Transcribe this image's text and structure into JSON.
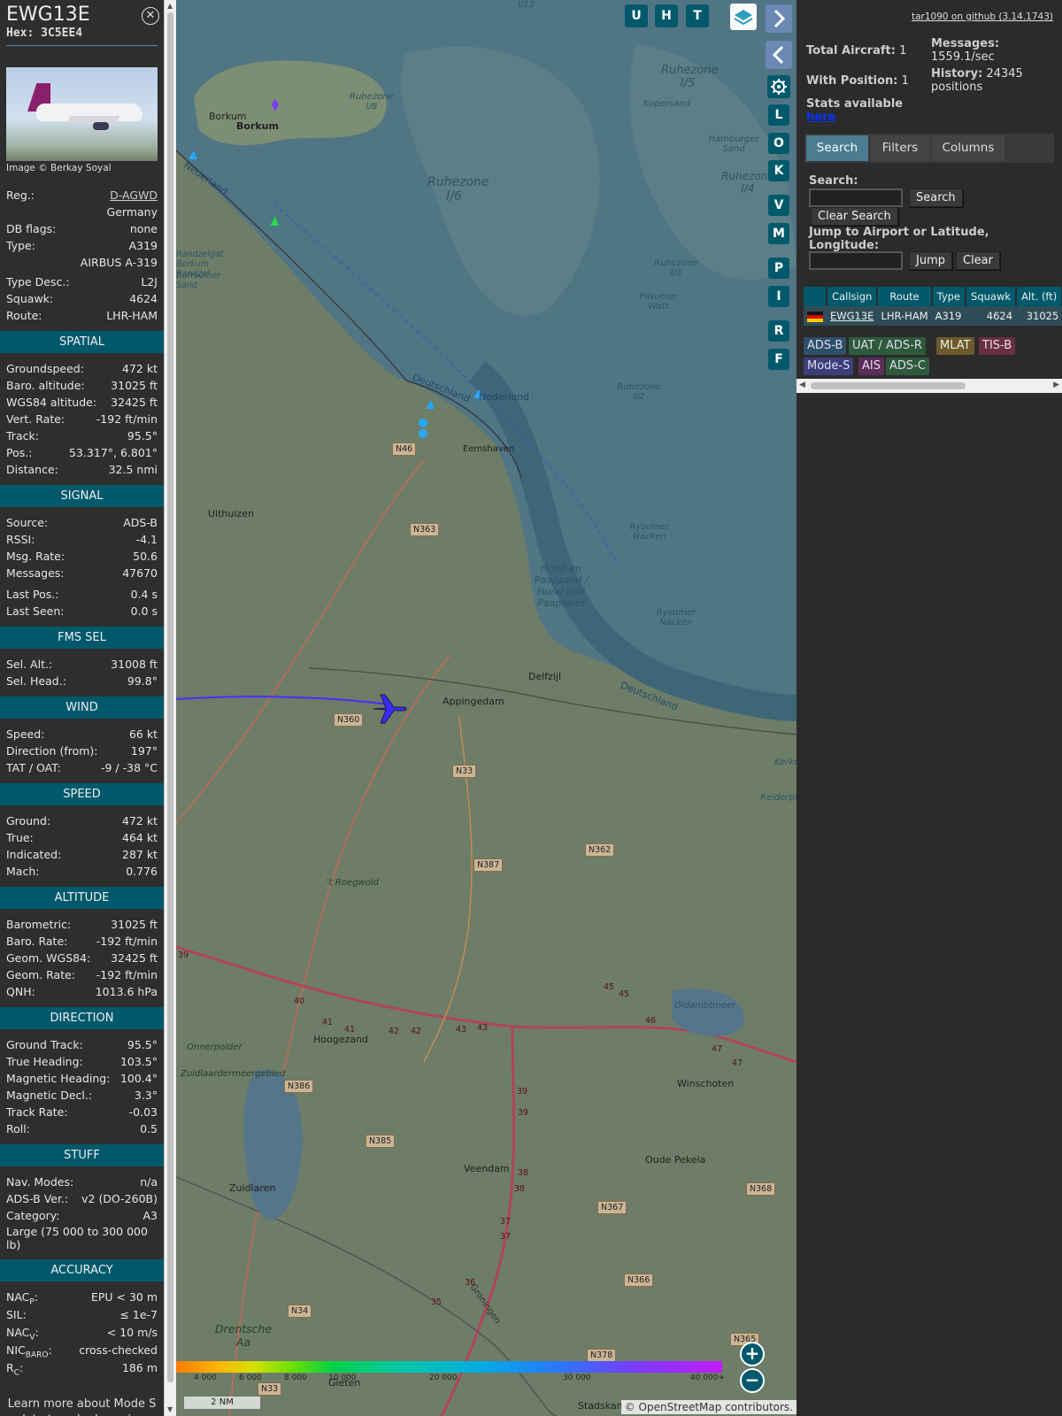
{
  "info": {
    "callsign": "EWG13E",
    "hex": "Hex: 3C5EE4",
    "photo_credit": "Image © Berkay Soyal",
    "reg_label": "Reg.:",
    "reg_value": "D-AGWD",
    "country": "Germany",
    "dbflags_label": "DB flags:",
    "dbflags_value": "none",
    "type_label": "Type:",
    "type_value": "A319",
    "type_name": "AIRBUS A-319",
    "typedesc_label": "Type Desc.:",
    "typedesc_value": "L2J",
    "squawk_label": "Squawk:",
    "squawk_value": "4624",
    "route_label": "Route:",
    "route_value": "LHR-HAM",
    "sections": {
      "spatial": "SPATIAL",
      "signal": "SIGNAL",
      "fms": "FMS SEL",
      "wind": "WIND",
      "speed": "SPEED",
      "altitude": "ALTITUDE",
      "direction": "DIRECTION",
      "stuff": "STUFF",
      "accuracy": "ACCURACY"
    },
    "spatial": [
      {
        "label": "Groundspeed:",
        "value": "472 kt"
      },
      {
        "label": "Baro. altitude:",
        "value": "31025 ft"
      },
      {
        "label": "WGS84 altitude:",
        "value": "32425 ft"
      },
      {
        "label": "Vert. Rate:",
        "value": "-192 ft/min"
      },
      {
        "label": "Track:",
        "value": "95.5°"
      },
      {
        "label": "Pos.:",
        "value": "53.317°, 6.801°"
      },
      {
        "label": "Distance:",
        "value": "32.5 nmi"
      }
    ],
    "signal": [
      {
        "label": "Source:",
        "value": "ADS-B"
      },
      {
        "label": "RSSI:",
        "value": "-4.1"
      },
      {
        "label": "Msg. Rate:",
        "value": "50.6"
      },
      {
        "label": "Messages:",
        "value": "47670"
      }
    ],
    "signal2": [
      {
        "label": "Last Pos.:",
        "value": "0.4 s"
      },
      {
        "label": "Last Seen:",
        "value": "0.0 s"
      }
    ],
    "fms": [
      {
        "label": "Sel. Alt.:",
        "value": "31008 ft"
      },
      {
        "label": "Sel. Head.:",
        "value": "99.8°"
      }
    ],
    "wind": [
      {
        "label": "Speed:",
        "value": "66 kt"
      },
      {
        "label": "Direction (from):",
        "value": "197°"
      },
      {
        "label": "TAT / OAT:",
        "value": "-9 / -38 °C"
      }
    ],
    "speed": [
      {
        "label": "Ground:",
        "value": "472 kt"
      },
      {
        "label": "True:",
        "value": "464 kt"
      },
      {
        "label": "Indicated:",
        "value": "287 kt"
      },
      {
        "label": "Mach:",
        "value": "0.776"
      }
    ],
    "altitude": [
      {
        "label": "Barometric:",
        "value": "31025 ft"
      },
      {
        "label": "Baro. Rate:",
        "value": "-192 ft/min"
      },
      {
        "label": "Geom. WGS84:",
        "value": "32425 ft"
      },
      {
        "label": "Geom. Rate:",
        "value": "-192 ft/min"
      },
      {
        "label": "QNH:",
        "value": "1013.6 hPa"
      }
    ],
    "direction": [
      {
        "label": "Ground Track:",
        "value": "95.5°"
      },
      {
        "label": "True Heading:",
        "value": "103.5°"
      },
      {
        "label": "Magnetic Heading:",
        "value": "100.4°"
      },
      {
        "label": "Magnetic Decl.:",
        "value": "3.3°"
      },
      {
        "label": "Track Rate:",
        "value": "-0.03"
      },
      {
        "label": "Roll:",
        "value": "0.5"
      }
    ],
    "stuff": [
      {
        "label": "Nav. Modes:",
        "value": "n/a"
      },
      {
        "label": "ADS-B Ver.:",
        "value": "v2 (DO-260B)"
      },
      {
        "label": "Category:",
        "value": "A3"
      }
    ],
    "category_desc": "Large (75 000 to 300 000 lb)",
    "accuracy": [
      {
        "label": "NAC",
        "sub": "P",
        "value": "EPU < 30 m"
      },
      {
        "label": "SIL:",
        "sub": "",
        "value": "≤ 1e-7"
      },
      {
        "label": "NAC",
        "sub": "V",
        "value": "< 10 m/s"
      },
      {
        "label": "NIC",
        "sub": "BARO",
        "value": "cross-checked"
      },
      {
        "label": "R",
        "sub": "C",
        "value": "186 m"
      }
    ],
    "footnote": "Learn more about Mode S data type by hovering over each data label."
  },
  "map": {
    "toolbar": {
      "u": "U",
      "h": "H",
      "t": "T"
    },
    "side_buttons": [
      "L",
      "O",
      "K",
      "V",
      "M",
      "P",
      "I",
      "R",
      "F"
    ],
    "places": {
      "borkum1": "Borkum",
      "borkum2": "Borkum",
      "nederland": "Nederland",
      "uithuizen": "Uithuizen",
      "eemshaven": "Eemshaven",
      "delfzijl": "Delfzijl",
      "appingedam": "Appingedam",
      "hoogezand": "Hoogezand",
      "winschoten": "Winschoten",
      "veendam": "Veendam",
      "oudepekela": "Oude Pekela",
      "zuidlaren": "Zuidlaren",
      "drentsche": "Drentsche Aa",
      "gieten": "Gieten",
      "stadskanaal": "Stadskan",
      "roegwold": "'t Roegwold",
      "onnerpolder": "Onnerpolder",
      "zuidlaardermeer": "Zuidlaardermeergebied",
      "oldambtmeer": "Oldambtmeer",
      "deutschland1": "Deutschland",
      "nederland2": "Nederland",
      "deutschland2": "Deutschland",
      "kopersand": "Kopersand",
      "hamburger": "Hamburger Sand",
      "pilsumer": "Pilsumer Watt",
      "rysumer1": "Rysumer Nacken",
      "rysumer2": "Rysumer Nacken",
      "hondpaap": "Hond en Paapzand / Hund und Paapsand",
      "ruhe1": "Ruhezone I/5",
      "ruhe2": "Ruhezone I/6",
      "ruhe3": "Ruhezone I/4",
      "ruhe4": "Ruhezone I/8",
      "ruhe5": "Ruhezone I/3",
      "ruhe6": "Ruhezone I/2",
      "ruhe7": "I/13",
      "borssum": "Borrsumer Sand",
      "kerke": "Kerke",
      "reiderpl": "Reiderpl",
      "randzelgat": "Randzelgat Borkum Randzel"
    },
    "roads": {
      "n46": "N46",
      "n363": "N363",
      "n360": "N360",
      "n33a": "N33",
      "n362": "N362",
      "n387": "N387",
      "n386": "N386",
      "n385": "N385",
      "n367": "N367",
      "n368": "N368",
      "n366": "N366",
      "n34": "N34",
      "n378": "N378",
      "n365": "N365",
      "n33b": "N33"
    },
    "exits": [
      "39",
      "40",
      "41",
      "41",
      "42",
      "42",
      "43",
      "43",
      "45",
      "45",
      "46",
      "47",
      "47",
      "39",
      "39",
      "38",
      "38",
      "37",
      "37",
      "36",
      "35"
    ],
    "groningen": "Groningen",
    "alt_ticks": [
      "4 000",
      "6 000",
      "8 000",
      "10 000",
      "20 000",
      "30 000",
      "40 000+"
    ],
    "scale": "2 NM",
    "credit_prefix": "©",
    "credit_link": "OpenStreetMap",
    "credit_suffix": "contributors."
  },
  "right": {
    "github": "tar1090 on github (3.14.1743)",
    "total_label": "Total Aircraft:",
    "total_value": "1",
    "withpos_label": "With Position:",
    "withpos_value": "1",
    "stats_label": "Stats available",
    "stats_link": "here",
    "messages_label": "Messages:",
    "messages_value": "1559.1/sec",
    "history_label": "History:",
    "history_value": "24345 positions",
    "tabs": [
      "Search",
      "Filters",
      "Columns"
    ],
    "search_label": "Search:",
    "search_button": "Search",
    "clear_search_button": "Clear Search",
    "jump_label": "Jump to Airport or Latitude, Longitude:",
    "jump_button": "Jump",
    "clear_button": "Clear",
    "table": {
      "headers": [
        "Callsign",
        "Route",
        "Type",
        "Squawk",
        "Alt. (ft)"
      ],
      "row": [
        "EWG13E",
        "LHR-HAM",
        "A319",
        "4624",
        "31025"
      ]
    },
    "sources": [
      {
        "label": "ADS-B",
        "bg": "#2d4f6a",
        "fg": "#dde"
      },
      {
        "label": "UAT / ADS-R",
        "bg": "#2e5a3c",
        "fg": "#dde"
      },
      {
        "label": "MLAT",
        "bg": "#6b5a2c",
        "fg": "#eed"
      },
      {
        "label": "TIS-B",
        "bg": "#6a2e46",
        "fg": "#edd"
      },
      {
        "label": "Mode-S",
        "bg": "#3d3d7a",
        "fg": "#dde"
      },
      {
        "label": "AIS",
        "bg": "#5a2e5a",
        "fg": "#ede"
      },
      {
        "label": "ADS-C",
        "bg": "#2e5a3c",
        "fg": "#dde"
      }
    ]
  }
}
